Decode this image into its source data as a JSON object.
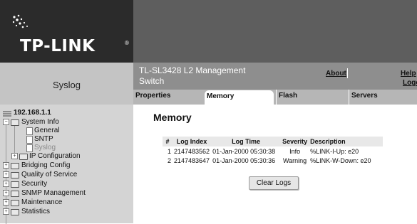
{
  "brand": {
    "logo_text": "TP-LINK",
    "logo_tm": "®"
  },
  "header": {
    "page_heading": "Syslog",
    "product_title": "TL-SL3428 L2 Management Switch",
    "links": {
      "about": "About",
      "help": "Help",
      "logout": "Logout"
    }
  },
  "tabs": [
    {
      "label": "Properties",
      "active": false
    },
    {
      "label": "Memory",
      "active": true
    },
    {
      "label": "Flash",
      "active": false
    },
    {
      "label": "Servers",
      "active": false
    }
  ],
  "sidebar": {
    "root": "192.168.1.1",
    "items": [
      {
        "label": "System Info",
        "expanded": true
      },
      {
        "label": "General"
      },
      {
        "label": "SNTP"
      },
      {
        "label": "Syslog",
        "selected": true
      },
      {
        "label": "IP Configuration"
      },
      {
        "label": "Bridging Config"
      },
      {
        "label": "Quality of Service"
      },
      {
        "label": "Security"
      },
      {
        "label": "SNMP Management"
      },
      {
        "label": "Maintenance"
      },
      {
        "label": "Statistics"
      }
    ]
  },
  "main": {
    "heading": "Memory",
    "table": {
      "columns": [
        "#",
        "Log Index",
        "Log Time",
        "Severity",
        "Description"
      ],
      "rows": [
        [
          "1",
          "2147483562",
          "01-Jan-2000 05:30:38",
          "Info",
          "%LINK-I-Up:  e20"
        ],
        [
          "2",
          "2147483647",
          "01-Jan-2000 05:30:36",
          "Warning",
          "%LINK-W-Down:  e20"
        ]
      ]
    },
    "clear_button": "Clear Logs"
  },
  "icons": {
    "tree_root": "network-icon",
    "folder": "folder-icon",
    "page": "page-icon"
  },
  "colors": {
    "header_dark": "#2b2b2b",
    "header_mid": "#5e5e5e",
    "subheader": "#8e8e8e",
    "sidebar_bg": "#d4d4d4",
    "tabbar_bg": "#b6b6b6"
  }
}
